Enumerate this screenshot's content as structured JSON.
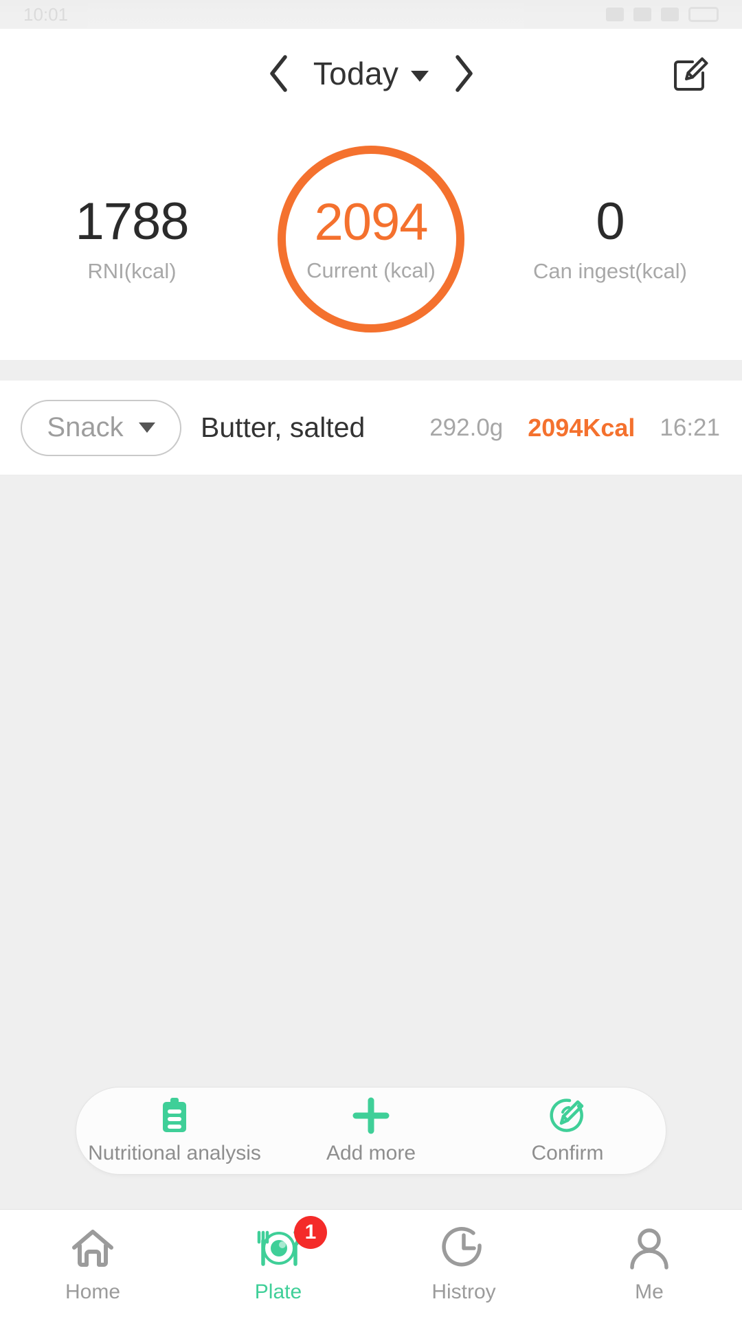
{
  "statusbar": {
    "time": "10:01"
  },
  "header": {
    "prev_icon": "chevron-left-icon",
    "next_icon": "chevron-right-icon",
    "date_label": "Today",
    "dropdown_icon": "caret-down-icon",
    "edit_icon": "edit-square-pencil-icon"
  },
  "summary": {
    "left": {
      "value": "1788",
      "label": "RNI(kcal)"
    },
    "center": {
      "value": "2094",
      "label": "Current (kcal)",
      "ring_color": "#f4712e"
    },
    "right": {
      "value": "0",
      "label": "Can ingest(kcal)"
    }
  },
  "food_list": {
    "rows": [
      {
        "meal": "Snack",
        "meal_caret": "caret-down-icon",
        "name": "Butter, salted",
        "weight": "292.0g",
        "kcal": "2094Kcal",
        "time": "16:21"
      }
    ]
  },
  "action_bar": {
    "items": [
      {
        "label": "Nutritional analysis",
        "icon": "clipboard-icon"
      },
      {
        "label": "Add more",
        "icon": "plus-icon"
      },
      {
        "label": "Confirm",
        "icon": "circle-pencil-icon"
      }
    ],
    "accent_color": "#3fcf98"
  },
  "tabbar": {
    "items": [
      {
        "label": "Home",
        "icon": "home-icon",
        "active": false,
        "badge": null
      },
      {
        "label": "Plate",
        "icon": "plate-fork-knife-icon",
        "active": true,
        "badge": "1"
      },
      {
        "label": "Histroy",
        "icon": "clock-icon",
        "active": false,
        "badge": null
      },
      {
        "label": "Me",
        "icon": "person-icon",
        "active": false,
        "badge": null
      }
    ],
    "active_color": "#3fcf98",
    "inactive_color": "#9b9b9b",
    "badge_color": "#f42b29"
  }
}
